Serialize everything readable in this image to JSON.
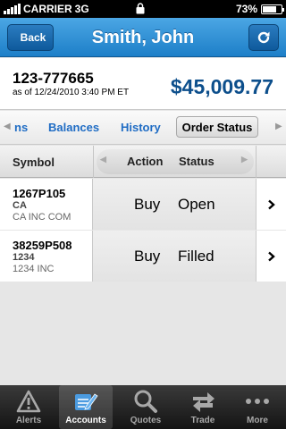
{
  "status": {
    "carrier": "CARRIER",
    "network": "3G",
    "battery": "73%",
    "battery_level": 0.73
  },
  "nav": {
    "back_label": "Back",
    "title": "Smith, John",
    "refresh_icon": "refresh-icon"
  },
  "account": {
    "number": "123-777665",
    "as_of": "as of 12/24/2010 3:40 PM ET",
    "value": "$45,009.77"
  },
  "tabs": {
    "partial": "ns",
    "balances": "Balances",
    "history": "History",
    "order_status": "Order Status"
  },
  "table": {
    "headers": {
      "symbol": "Symbol",
      "action": "Action",
      "status": "Status"
    },
    "rows": [
      {
        "symbol": "1267P105",
        "sub": "CA",
        "name": "CA INC COM",
        "action": "Buy",
        "status": "Open"
      },
      {
        "symbol": "38259P508",
        "sub": "1234",
        "name": "1234 INC",
        "action": "Buy",
        "status": "Filled"
      }
    ]
  },
  "bottom_tabs": [
    {
      "label": "Alerts",
      "icon": "alert-icon"
    },
    {
      "label": "Accounts",
      "icon": "accounts-icon"
    },
    {
      "label": "Quotes",
      "icon": "search-icon"
    },
    {
      "label": "Trade",
      "icon": "trade-icon"
    },
    {
      "label": "More",
      "icon": "more-icon"
    }
  ],
  "colors": {
    "nav": "#1d7fc8",
    "accent": "#1f6cc4",
    "value": "#0d4f8c"
  }
}
